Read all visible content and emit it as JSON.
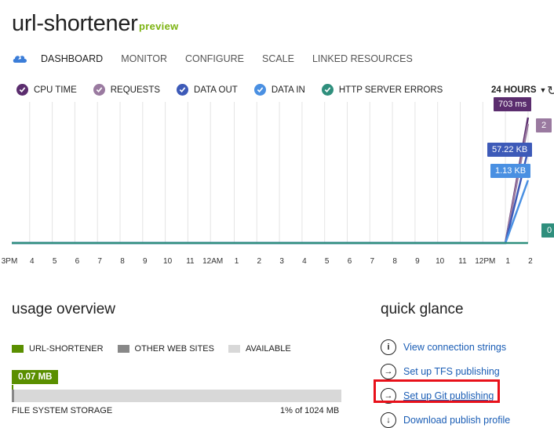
{
  "app": {
    "title": "url-shortener",
    "badge": "preview"
  },
  "nav": {
    "icon": "cloud-icon",
    "items": [
      "DASHBOARD",
      "MONITOR",
      "CONFIGURE",
      "SCALE",
      "LINKED RESOURCES"
    ],
    "active": "DASHBOARD"
  },
  "metrics_legend": [
    {
      "label": "CPU TIME",
      "color": "#5b2d6e"
    },
    {
      "label": "REQUESTS",
      "color": "#9a7aa0"
    },
    {
      "label": "DATA OUT",
      "color": "#3d5ab8"
    },
    {
      "label": "DATA IN",
      "color": "#4a90e2"
    },
    {
      "label": "HTTP SERVER ERRORS",
      "color": "#2f8f7d"
    }
  ],
  "time_range": "24 HOURS",
  "callouts": {
    "cpu_time": "703 ms",
    "data_out": "57.22 KB",
    "data_in": "1.13 KB",
    "requests": "2",
    "errors": "0"
  },
  "chart_data": {
    "type": "line",
    "x": [
      "3PM",
      "4",
      "5",
      "6",
      "7",
      "8",
      "9",
      "10",
      "11",
      "12AM",
      "1",
      "2",
      "3",
      "4",
      "5",
      "6",
      "7",
      "8",
      "9",
      "10",
      "11",
      "12PM",
      "1",
      "2"
    ],
    "series": [
      {
        "name": "CPU TIME",
        "values": [
          0,
          0,
          0,
          0,
          0,
          0,
          0,
          0,
          0,
          0,
          0,
          0,
          0,
          0,
          0,
          0,
          0,
          0,
          0,
          0,
          0,
          0,
          0,
          703
        ]
      },
      {
        "name": "REQUESTS",
        "values": [
          0,
          0,
          0,
          0,
          0,
          0,
          0,
          0,
          0,
          0,
          0,
          0,
          0,
          0,
          0,
          0,
          0,
          0,
          0,
          0,
          0,
          0,
          0,
          2
        ]
      },
      {
        "name": "DATA OUT",
        "values": [
          0,
          0,
          0,
          0,
          0,
          0,
          0,
          0,
          0,
          0,
          0,
          0,
          0,
          0,
          0,
          0,
          0,
          0,
          0,
          0,
          0,
          0,
          0,
          57.22
        ]
      },
      {
        "name": "DATA IN",
        "values": [
          0,
          0,
          0,
          0,
          0,
          0,
          0,
          0,
          0,
          0,
          0,
          0,
          0,
          0,
          0,
          0,
          0,
          0,
          0,
          0,
          0,
          0,
          0,
          1.13
        ]
      },
      {
        "name": "HTTP SERVER ERRORS",
        "values": [
          0,
          0,
          0,
          0,
          0,
          0,
          0,
          0,
          0,
          0,
          0,
          0,
          0,
          0,
          0,
          0,
          0,
          0,
          0,
          0,
          0,
          0,
          0,
          0
        ]
      }
    ]
  },
  "usage": {
    "title": "usage overview",
    "legend": [
      {
        "label": "URL-SHORTENER",
        "color": "#5a8f00"
      },
      {
        "label": "OTHER WEB SITES",
        "color": "#888888"
      },
      {
        "label": "AVAILABLE",
        "color": "#d8d8d8"
      }
    ],
    "storage_value": "0.07 MB",
    "storage_label": "FILE SYSTEM STORAGE",
    "storage_pct_text": "1% of 1024 MB",
    "storage_fraction": 0.01
  },
  "quick": {
    "title": "quick glance",
    "links": [
      {
        "label": "View connection strings",
        "icon": "info-icon"
      },
      {
        "label": "Set up TFS publishing",
        "icon": "arrow-right-icon"
      },
      {
        "label": "Set up Git publishing",
        "icon": "arrow-right-icon"
      },
      {
        "label": "Download publish profile",
        "icon": "download-icon"
      }
    ]
  }
}
